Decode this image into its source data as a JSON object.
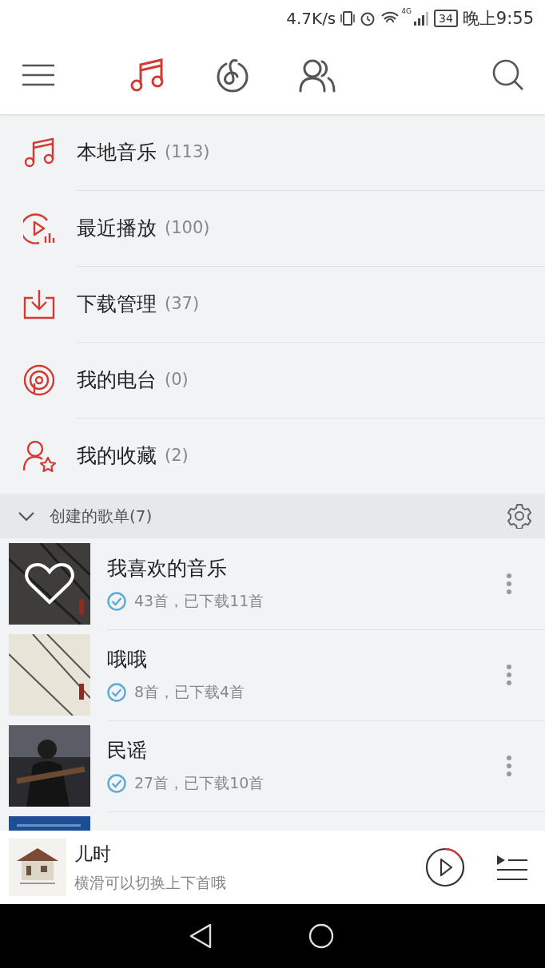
{
  "status_bar": {
    "speed": "4.7K/s",
    "network": "4G",
    "battery": "34",
    "time": "晚上9:55"
  },
  "tabs": [
    {
      "kind": "music",
      "selected": true
    },
    {
      "kind": "discover",
      "selected": false
    },
    {
      "kind": "friends",
      "selected": false
    }
  ],
  "menu": [
    {
      "kind": "music",
      "label": "本地音乐",
      "count": "(113)"
    },
    {
      "kind": "recent",
      "label": "最近播放",
      "count": "(100)"
    },
    {
      "kind": "download",
      "label": "下载管理",
      "count": "(37)"
    },
    {
      "kind": "radio",
      "label": "我的电台",
      "count": "(0)"
    },
    {
      "kind": "favorite",
      "label": "我的收藏",
      "count": "(2)"
    }
  ],
  "section": {
    "title": "创建的歌单(7)",
    "expanded": true
  },
  "playlists": [
    {
      "kind": "full",
      "title": "我喜欢的音乐",
      "detail": "43首，已下载11首",
      "liked": true,
      "downloaded": true
    },
    {
      "kind": "full",
      "title": "哦哦",
      "detail": "8首，已下载4首",
      "liked": false,
      "downloaded": true
    },
    {
      "kind": "full",
      "title": "民谣",
      "detail": "27首，已下载10首",
      "liked": false,
      "downloaded": true
    },
    {
      "kind": "cut_off"
    }
  ],
  "player": {
    "title": "儿时",
    "subtitle": "横滑可以切换上下首哦"
  }
}
